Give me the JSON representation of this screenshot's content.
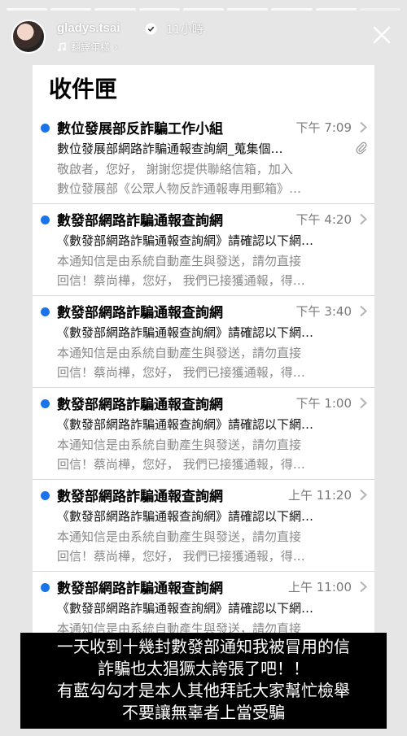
{
  "story": {
    "progress_total": 9,
    "progress_current": 9,
    "username": "gladys.tsai",
    "time_ago": "11小時",
    "music_label": "翻譯年糕",
    "icons": {
      "verified": "verified-badge-icon",
      "music": "music-note-icon",
      "close": "close-icon"
    }
  },
  "mail": {
    "title": "收件匣",
    "accent_color": "#1a73e8",
    "items": [
      {
        "sender": "數位發展部反詐騙工作小組",
        "time": "下午 7:09",
        "subject": "數位發展部網路詐騙通報查詢網_蒐集個…",
        "preview_line1": "敬啟者，您好，  謝謝您提供聯絡信箱，加入",
        "preview_line2": "數位發展部《公眾人物反詐通報專用郵箱》…",
        "has_attachment": true
      },
      {
        "sender": "數發部網路詐騙通報查詢網",
        "time": "下午 4:20",
        "subject": "《數發部網路詐騙通報查詢網》請確認以下網…",
        "preview_line1": "本通知信是由系統自動產生與發送，請勿直接",
        "preview_line2": "回信！蔡尚樺，您好，  我們已接獲通報，得…",
        "has_attachment": false
      },
      {
        "sender": "數發部網路詐騙通報查詢網",
        "time": "下午 3:40",
        "subject": "《數發部網路詐騙通報查詢網》請確認以下網…",
        "preview_line1": "本通知信是由系統自動產生與發送，請勿直接",
        "preview_line2": "回信！蔡尚樺，您好，  我們已接獲通報，得…",
        "has_attachment": false
      },
      {
        "sender": "數發部網路詐騙通報查詢網",
        "time": "下午 1:00",
        "subject": "《數發部網路詐騙通報查詢網》請確認以下網…",
        "preview_line1": "本通知信是由系統自動產生與發送，請勿直接",
        "preview_line2": "回信！蔡尚樺，您好，  我們已接獲通報，得…",
        "has_attachment": false
      },
      {
        "sender": "數發部網路詐騙通報查詢網",
        "time": "上午 11:20",
        "subject": "《數發部網路詐騙通報查詢網》請確認以下網…",
        "preview_line1": "本通知信是由系統自動產生與發送，請勿直接",
        "preview_line2": "回信！蔡尚樺，您好，  我們已接獲通報，得…",
        "has_attachment": false
      },
      {
        "sender": "數發部網路詐騙通報查詢網",
        "time": "上午 11:00",
        "subject": "《數發部網路詐騙通報查詢網》請確認以下網…",
        "preview_line1": "本通知信是由系統自動產生與發送，請勿直接",
        "preview_line2": "",
        "has_attachment": false
      }
    ]
  },
  "caption": {
    "line1": "一天收到十幾封數發部通知我被冒用的信",
    "line2": "詐騙也太猖獗太誇張了吧！！",
    "line3": "有藍勾勾才是本人其他拜託大家幫忙檢舉",
    "line4": "不要讓無辜者上當受騙"
  }
}
